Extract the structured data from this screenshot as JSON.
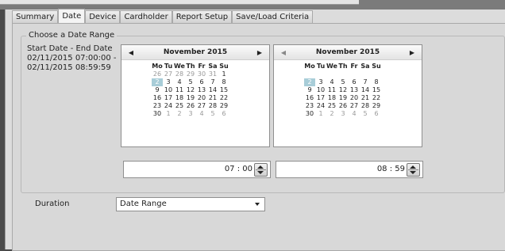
{
  "tabs": [
    {
      "label": "Summary",
      "active": false
    },
    {
      "label": "Date",
      "active": true
    },
    {
      "label": "Device",
      "active": false
    },
    {
      "label": "Cardholder",
      "active": false
    },
    {
      "label": "Report Setup",
      "active": false
    },
    {
      "label": "Save/Load Criteria",
      "active": false
    }
  ],
  "date_range": {
    "legend": "Choose a Date Range",
    "summary_lines": [
      "Start Date - End Date",
      "02/11/2015 07:00:00 -",
      "02/11/2015 08:59:59"
    ]
  },
  "calendars": [
    {
      "month_label": "November 2015",
      "prev_icon": "triangle-left",
      "next_icon": "triangle-right",
      "weekdays": [
        "Mo",
        "Tu",
        "We",
        "Th",
        "Fr",
        "Sa",
        "Su"
      ],
      "weeks": [
        [
          {
            "d": "26",
            "o": true
          },
          {
            "d": "27",
            "o": true
          },
          {
            "d": "28",
            "o": true
          },
          {
            "d": "29",
            "o": true
          },
          {
            "d": "30",
            "o": true
          },
          {
            "d": "31",
            "o": true
          },
          {
            "d": "1",
            "o": false
          }
        ],
        [
          {
            "d": "2",
            "o": false,
            "sel": true
          },
          {
            "d": "3",
            "o": false
          },
          {
            "d": "4",
            "o": false
          },
          {
            "d": "5",
            "o": false
          },
          {
            "d": "6",
            "o": false
          },
          {
            "d": "7",
            "o": false
          },
          {
            "d": "8",
            "o": false
          }
        ],
        [
          {
            "d": "9",
            "o": false
          },
          {
            "d": "10",
            "o": false
          },
          {
            "d": "11",
            "o": false
          },
          {
            "d": "12",
            "o": false
          },
          {
            "d": "13",
            "o": false
          },
          {
            "d": "14",
            "o": false
          },
          {
            "d": "15",
            "o": false
          }
        ],
        [
          {
            "d": "16",
            "o": false
          },
          {
            "d": "17",
            "o": false
          },
          {
            "d": "18",
            "o": false
          },
          {
            "d": "19",
            "o": false
          },
          {
            "d": "20",
            "o": false
          },
          {
            "d": "21",
            "o": false
          },
          {
            "d": "22",
            "o": false
          }
        ],
        [
          {
            "d": "23",
            "o": false
          },
          {
            "d": "24",
            "o": false
          },
          {
            "d": "25",
            "o": false
          },
          {
            "d": "26",
            "o": false
          },
          {
            "d": "27",
            "o": false
          },
          {
            "d": "28",
            "o": false
          },
          {
            "d": "29",
            "o": false
          }
        ],
        [
          {
            "d": "30",
            "o": false
          },
          {
            "d": "1",
            "o": true
          },
          {
            "d": "2",
            "o": true
          },
          {
            "d": "3",
            "o": true
          },
          {
            "d": "4",
            "o": true
          },
          {
            "d": "5",
            "o": true
          },
          {
            "d": "6",
            "o": true
          }
        ]
      ],
      "time": "07 : 00"
    },
    {
      "month_label": "November 2015",
      "prev_icon": "triangle-left",
      "next_icon": "triangle-right",
      "weekdays": [
        "Mo",
        "Tu",
        "We",
        "Th",
        "Fr",
        "Sa",
        "Su"
      ],
      "weeks": [
        [
          {
            "d": "",
            "o": true
          },
          {
            "d": "",
            "o": true
          },
          {
            "d": "",
            "o": true
          },
          {
            "d": "",
            "o": true
          },
          {
            "d": "",
            "o": true
          },
          {
            "d": "",
            "o": true
          },
          {
            "d": "",
            "o": true
          }
        ],
        [
          {
            "d": "2",
            "o": false,
            "sel": true
          },
          {
            "d": "3",
            "o": false
          },
          {
            "d": "4",
            "o": false
          },
          {
            "d": "5",
            "o": false
          },
          {
            "d": "6",
            "o": false
          },
          {
            "d": "7",
            "o": false
          },
          {
            "d": "8",
            "o": false
          }
        ],
        [
          {
            "d": "9",
            "o": false
          },
          {
            "d": "10",
            "o": false
          },
          {
            "d": "11",
            "o": false
          },
          {
            "d": "12",
            "o": false
          },
          {
            "d": "13",
            "o": false
          },
          {
            "d": "14",
            "o": false
          },
          {
            "d": "15",
            "o": false
          }
        ],
        [
          {
            "d": "16",
            "o": false
          },
          {
            "d": "17",
            "o": false
          },
          {
            "d": "18",
            "o": false
          },
          {
            "d": "19",
            "o": false
          },
          {
            "d": "20",
            "o": false
          },
          {
            "d": "21",
            "o": false
          },
          {
            "d": "22",
            "o": false
          }
        ],
        [
          {
            "d": "23",
            "o": false
          },
          {
            "d": "24",
            "o": false
          },
          {
            "d": "25",
            "o": false
          },
          {
            "d": "26",
            "o": false
          },
          {
            "d": "27",
            "o": false
          },
          {
            "d": "28",
            "o": false
          },
          {
            "d": "29",
            "o": false
          }
        ],
        [
          {
            "d": "30",
            "o": false
          },
          {
            "d": "1",
            "o": true
          },
          {
            "d": "2",
            "o": true
          },
          {
            "d": "3",
            "o": true
          },
          {
            "d": "4",
            "o": true
          },
          {
            "d": "5",
            "o": true
          },
          {
            "d": "6",
            "o": true
          }
        ]
      ],
      "time": "08 : 59"
    }
  ],
  "duration": {
    "label": "Duration",
    "selected": "Date Range"
  },
  "colors": {
    "selected_day": "#a8cdd8",
    "panel_bg": "#d8d8d8"
  }
}
